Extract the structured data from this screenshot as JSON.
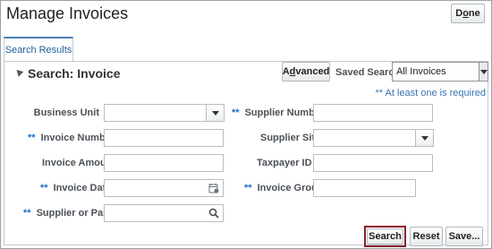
{
  "header": {
    "title": "Manage Invoices",
    "done_label_prefix": "D",
    "done_label_underline": "o",
    "done_label_suffix": "ne"
  },
  "tabs": [
    {
      "label": "Search Results"
    }
  ],
  "search": {
    "title": "Search: Invoice",
    "advanced_prefix": "A",
    "advanced_underline": "d",
    "advanced_suffix": "vanced",
    "saved_search_label": "Saved Search",
    "saved_search_value": "All Invoices",
    "required_note": "** At least one is required",
    "req_marker": "**"
  },
  "fields": {
    "business_unit": {
      "label": "Business Unit",
      "value": ""
    },
    "supplier_number": {
      "label": "Supplier Number",
      "value": ""
    },
    "invoice_number": {
      "label": "Invoice Number",
      "value": ""
    },
    "supplier_site": {
      "label": "Supplier Site",
      "value": ""
    },
    "invoice_amount": {
      "label": "Invoice Amount",
      "value": ""
    },
    "taxpayer_id": {
      "label": "Taxpayer ID",
      "value": ""
    },
    "invoice_date": {
      "label": "Invoice Date",
      "value": ""
    },
    "invoice_group": {
      "label": "Invoice Group",
      "value": ""
    },
    "supplier_or_party": {
      "label": "Supplier or Party",
      "value": ""
    }
  },
  "actions": {
    "search_label": "Search",
    "reset_label": "Reset",
    "save_label": "Save..."
  }
}
